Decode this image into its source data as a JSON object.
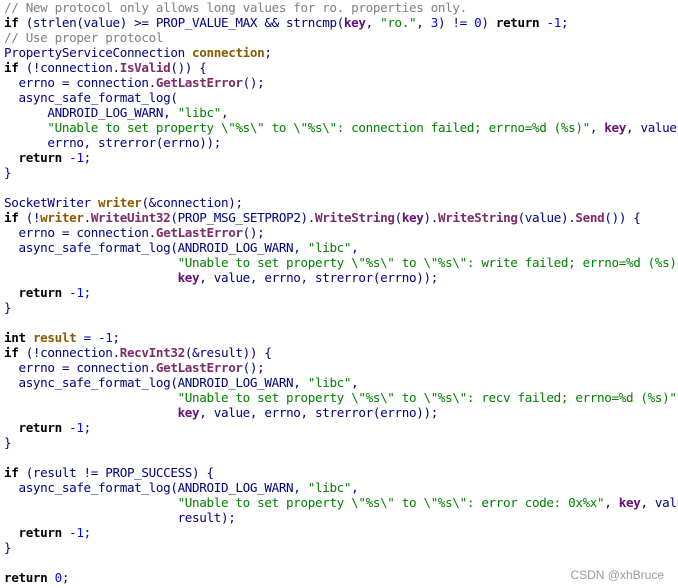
{
  "code_lines": [
    [
      [
        "cm",
        "// New protocol only allows long values for ro. properties only."
      ]
    ],
    [
      [
        "kw",
        "if"
      ],
      [
        "pl",
        " (strlen(value) >= PROP_VALUE_MAX && strncmp("
      ],
      [
        "ac",
        "key"
      ],
      [
        "pl",
        ", "
      ],
      [
        "st",
        "\"ro.\""
      ],
      [
        "pl",
        ", "
      ],
      [
        "nu",
        "3"
      ],
      [
        "pl",
        ") != "
      ],
      [
        "nu",
        "0"
      ],
      [
        "pl",
        ") "
      ],
      [
        "kw",
        "return"
      ],
      [
        "pl",
        " "
      ],
      [
        "nu",
        "-1"
      ],
      [
        "pl",
        ";"
      ]
    ],
    [
      [
        "cm",
        "// Use proper protocol"
      ]
    ],
    [
      [
        "pl",
        "PropertyServiceConnection "
      ],
      [
        "lv",
        "connection"
      ],
      [
        "pl",
        ";"
      ]
    ],
    [
      [
        "kw",
        "if"
      ],
      [
        "pl",
        " (!connection."
      ],
      [
        "fn",
        "IsValid"
      ],
      [
        "pl",
        "()) {"
      ]
    ],
    [
      [
        "pl",
        "  errno = connection."
      ],
      [
        "fn",
        "GetLastError"
      ],
      [
        "pl",
        "();"
      ]
    ],
    [
      [
        "pl",
        "  async_safe_format_log("
      ]
    ],
    [
      [
        "pl",
        "      ANDROID_LOG_WARN, "
      ],
      [
        "st",
        "\"libc\""
      ],
      [
        "pl",
        ","
      ]
    ],
    [
      [
        "pl",
        "      "
      ],
      [
        "st",
        "\"Unable to set property \\\"%s\\\" to \\\"%s\\\": connection failed; errno=%d (%s)\""
      ],
      [
        "pl",
        ", "
      ],
      [
        "ac",
        "key"
      ],
      [
        "pl",
        ", value,"
      ]
    ],
    [
      [
        "pl",
        "      errno, strerror(errno));"
      ]
    ],
    [
      [
        "pl",
        "  "
      ],
      [
        "kw",
        "return"
      ],
      [
        "pl",
        " "
      ],
      [
        "nu",
        "-1"
      ],
      [
        "pl",
        ";"
      ]
    ],
    [
      [
        "pl",
        "}"
      ]
    ],
    [],
    [
      [
        "pl",
        "SocketWriter "
      ],
      [
        "lv",
        "writer"
      ],
      [
        "pl",
        "(&connection);"
      ]
    ],
    [
      [
        "kw",
        "if"
      ],
      [
        "pl",
        " (!"
      ],
      [
        "lv",
        "writer"
      ],
      [
        "pl",
        "."
      ],
      [
        "fn",
        "WriteUint32"
      ],
      [
        "pl",
        "(PROP_MSG_SETPROP2)."
      ],
      [
        "fn",
        "WriteString"
      ],
      [
        "pl",
        "("
      ],
      [
        "ac",
        "key"
      ],
      [
        "pl",
        ")."
      ],
      [
        "fn",
        "WriteString"
      ],
      [
        "pl",
        "(value)."
      ],
      [
        "fn",
        "Send"
      ],
      [
        "pl",
        "()) {"
      ]
    ],
    [
      [
        "pl",
        "  errno = connection."
      ],
      [
        "fn",
        "GetLastError"
      ],
      [
        "pl",
        "();"
      ]
    ],
    [
      [
        "pl",
        "  async_safe_format_log(ANDROID_LOG_WARN, "
      ],
      [
        "st",
        "\"libc\""
      ],
      [
        "pl",
        ","
      ]
    ],
    [
      [
        "pl",
        "                        "
      ],
      [
        "st",
        "\"Unable to set property \\\"%s\\\" to \\\"%s\\\": write failed; errno=%d (%s)\""
      ],
      [
        "pl",
        ","
      ]
    ],
    [
      [
        "pl",
        "                        "
      ],
      [
        "ac",
        "key"
      ],
      [
        "pl",
        ", value, errno, strerror(errno));"
      ]
    ],
    [
      [
        "pl",
        "  "
      ],
      [
        "kw",
        "return"
      ],
      [
        "pl",
        " "
      ],
      [
        "nu",
        "-1"
      ],
      [
        "pl",
        ";"
      ]
    ],
    [
      [
        "pl",
        "}"
      ]
    ],
    [],
    [
      [
        "kw",
        "int"
      ],
      [
        "pl",
        " "
      ],
      [
        "lv",
        "result"
      ],
      [
        "pl",
        " = "
      ],
      [
        "nu",
        "-1"
      ],
      [
        "pl",
        ";"
      ]
    ],
    [
      [
        "kw",
        "if"
      ],
      [
        "pl",
        " (!connection."
      ],
      [
        "fn",
        "RecvInt32"
      ],
      [
        "pl",
        "(&result)) {"
      ]
    ],
    [
      [
        "pl",
        "  errno = connection."
      ],
      [
        "fn",
        "GetLastError"
      ],
      [
        "pl",
        "();"
      ]
    ],
    [
      [
        "pl",
        "  async_safe_format_log(ANDROID_LOG_WARN, "
      ],
      [
        "st",
        "\"libc\""
      ],
      [
        "pl",
        ","
      ]
    ],
    [
      [
        "pl",
        "                        "
      ],
      [
        "st",
        "\"Unable to set property \\\"%s\\\" to \\\"%s\\\": recv failed; errno=%d (%s)\""
      ],
      [
        "pl",
        ","
      ]
    ],
    [
      [
        "pl",
        "                        "
      ],
      [
        "ac",
        "key"
      ],
      [
        "pl",
        ", value, errno, strerror(errno));"
      ]
    ],
    [
      [
        "pl",
        "  "
      ],
      [
        "kw",
        "return"
      ],
      [
        "pl",
        " "
      ],
      [
        "nu",
        "-1"
      ],
      [
        "pl",
        ";"
      ]
    ],
    [
      [
        "pl",
        "}"
      ]
    ],
    [],
    [
      [
        "kw",
        "if"
      ],
      [
        "pl",
        " (result != PROP_SUCCESS) {"
      ]
    ],
    [
      [
        "pl",
        "  async_safe_format_log(ANDROID_LOG_WARN, "
      ],
      [
        "st",
        "\"libc\""
      ],
      [
        "pl",
        ","
      ]
    ],
    [
      [
        "pl",
        "                        "
      ],
      [
        "st",
        "\"Unable to set property \\\"%s\\\" to \\\"%s\\\": error code: 0x%x\""
      ],
      [
        "pl",
        ", "
      ],
      [
        "ac",
        "key"
      ],
      [
        "pl",
        ", value,"
      ]
    ],
    [
      [
        "pl",
        "                        result);"
      ]
    ],
    [
      [
        "pl",
        "  "
      ],
      [
        "kw",
        "return"
      ],
      [
        "pl",
        " "
      ],
      [
        "nu",
        "-1"
      ],
      [
        "pl",
        ";"
      ]
    ],
    [
      [
        "pl",
        "}"
      ]
    ],
    [],
    [
      [
        "kw",
        "return"
      ],
      [
        "pl",
        " "
      ],
      [
        "nu",
        "0"
      ],
      [
        "pl",
        ";"
      ]
    ]
  ],
  "token_classes": {
    "kw": "keyword",
    "cm": "comment",
    "pl": "plain",
    "fn": "method-call",
    "st": "string-literal",
    "nu": "number-literal",
    "lv": "local-variable",
    "ac": "parameter"
  },
  "colors": {
    "background": "#ffffff",
    "keyword": "#000000",
    "comment": "#808080",
    "plain": "#000080",
    "method": "#7b2c66",
    "string": "#008000",
    "number": "#0000ff",
    "local_variable": "#8b5a00",
    "parameter": "#660e7a",
    "watermark": "#9a9a9a"
  },
  "watermark": "CSDN @xhBruce"
}
